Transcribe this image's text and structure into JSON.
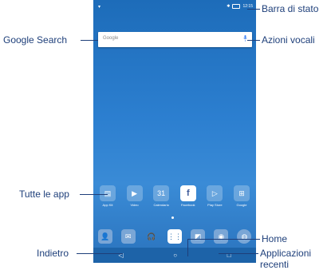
{
  "callouts": {
    "status_bar": "Barra di stato",
    "google_search": "Google Search",
    "voice_actions": "Azioni vocali",
    "all_apps": "Tutte le app",
    "back": "Indietro",
    "home": "Home",
    "recent_apps": "Applicazioni recenti"
  },
  "status_bar": {
    "left_icon": "android-icon",
    "time": "12:15"
  },
  "search_bar": {
    "label": "Google"
  },
  "apps": [
    {
      "label": "App Kit",
      "icon": "app-kit-icon",
      "color": "#5a8fd0"
    },
    {
      "label": "Video",
      "icon": "video-icon",
      "color": "#7ea8dd"
    },
    {
      "label": "Calendario",
      "icon": "calendar-icon",
      "color": "#8fb1d8"
    },
    {
      "label": "Facebook",
      "icon": "facebook-icon",
      "color": "#ffffff"
    },
    {
      "label": "Play Store",
      "icon": "play-store-icon",
      "color": "#8fb1d8"
    },
    {
      "label": "Google",
      "icon": "google-folder-icon",
      "color": "#8fb1d8"
    }
  ],
  "dock": [
    "contacts-icon",
    "messages-icon",
    "music-icon",
    "all-apps-icon",
    "gallery-icon",
    "camera-icon",
    "browser-icon"
  ],
  "nav": {
    "back": "◁",
    "home": "○",
    "recent": "□"
  }
}
